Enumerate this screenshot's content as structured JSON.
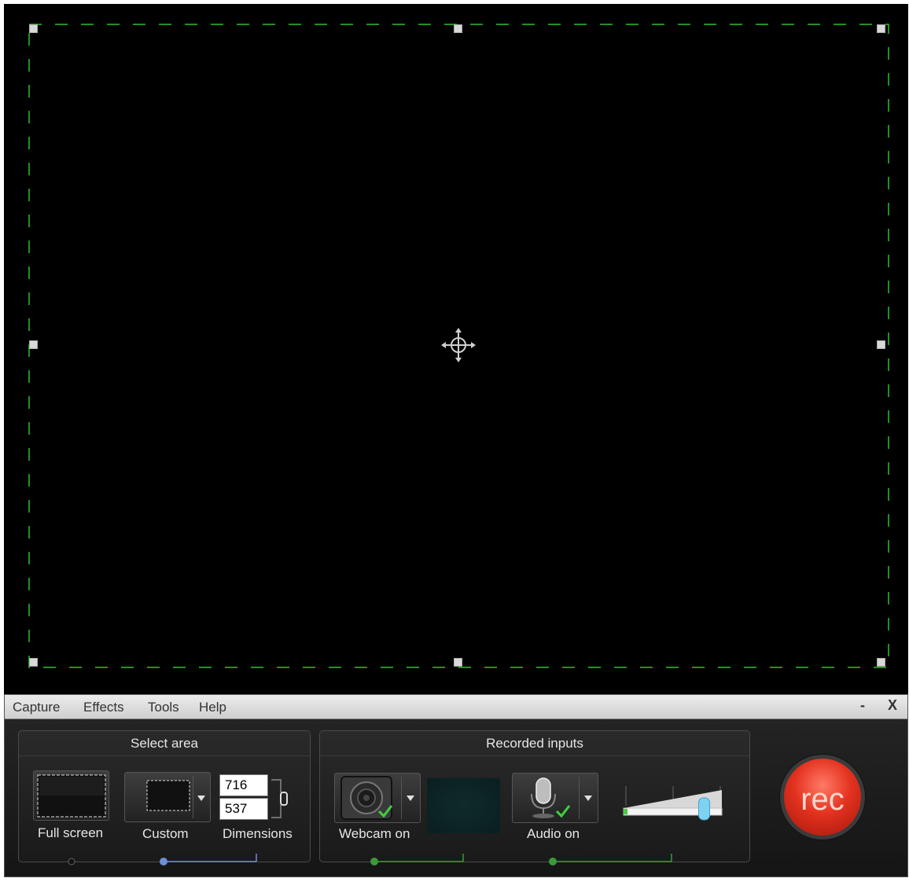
{
  "menu": {
    "items": [
      "Capture",
      "Effects",
      "Tools",
      "Help"
    ],
    "minimize_label": "-",
    "close_label": "X"
  },
  "select_area": {
    "header": "Select area",
    "full_screen_label": "Full screen",
    "custom_label": "Custom",
    "dimensions_label": "Dimensions",
    "width_value": "716",
    "height_value": "537"
  },
  "recorded_inputs": {
    "header": "Recorded inputs",
    "webcam_label": "Webcam on",
    "audio_label": "Audio on",
    "audio_level_fraction": 0.82
  },
  "rec_button_label": "rec",
  "colors": {
    "selection_border": "#2fbf2f",
    "rec_red": "#e3321f",
    "check_green": "#3fd23f",
    "connector_green": "#3a9a3a",
    "connector_blue": "#6c8fd8"
  }
}
